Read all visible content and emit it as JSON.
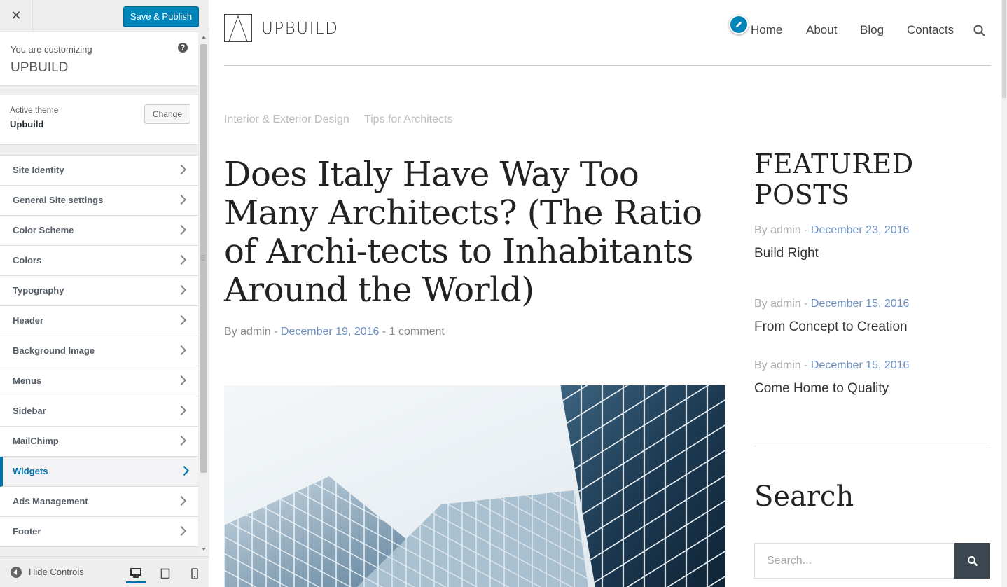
{
  "customizer": {
    "close_icon": "close-icon",
    "save_label": "Save & Publish",
    "customizing_prefix": "You are customizing",
    "site_name": "UPBUILD",
    "help_glyph": "?",
    "active_theme_label": "Active theme",
    "active_theme_name": "Upbuild",
    "change_label": "Change",
    "sections": [
      {
        "label": "Site Identity"
      },
      {
        "label": "General Site settings"
      },
      {
        "label": "Color Scheme"
      },
      {
        "label": "Colors"
      },
      {
        "label": "Typography"
      },
      {
        "label": "Header"
      },
      {
        "label": "Background Image"
      },
      {
        "label": "Menus"
      },
      {
        "label": "Sidebar"
      },
      {
        "label": "MailChimp"
      },
      {
        "label": "Widgets"
      },
      {
        "label": "Ads Management"
      },
      {
        "label": "Footer"
      }
    ],
    "active_section": "Widgets",
    "hide_controls_label": "Hide Controls",
    "preview_devices": [
      "desktop",
      "tablet",
      "mobile"
    ],
    "accent_color": "#0085ba"
  },
  "site": {
    "title": "UPBUILD",
    "nav": [
      "Home",
      "About",
      "Blog",
      "Contacts"
    ],
    "categories": [
      "Interior & Exterior Design",
      "Tips for Architects"
    ],
    "post": {
      "title": "Does Italy Have Way Too Many Architects? (The Ratio of Archi-tects to Inhabitants Around the World)",
      "author_prefix": "By admin -",
      "date": "December 19, 2016",
      "comments": "- 1 comment"
    },
    "featured": {
      "heading": "FEATURED POSTS",
      "posts": [
        {
          "author": "By admin -",
          "date": "December 23, 2016",
          "title": "Build Right"
        },
        {
          "author": "By admin -",
          "date": "December 15, 2016",
          "title": "From Concept to Creation"
        },
        {
          "author": "By admin -",
          "date": "December 15, 2016",
          "title": "Come Home to Quality"
        }
      ]
    },
    "search": {
      "heading": "Search",
      "placeholder": "Search..."
    },
    "link_color": "#6d8fc2"
  }
}
